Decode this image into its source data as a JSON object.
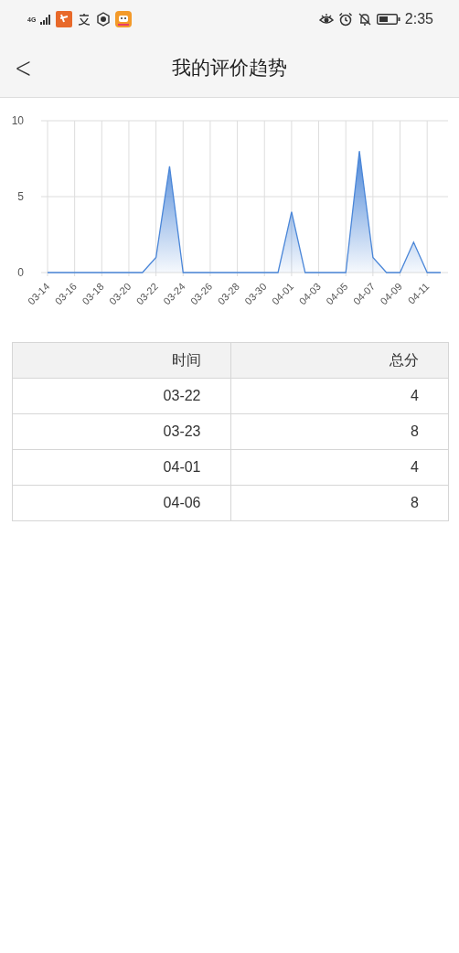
{
  "status_bar": {
    "network": "4G",
    "time": "2:35"
  },
  "header": {
    "back": "<",
    "title": "我的评价趋势"
  },
  "chart": {
    "chart_data": {
      "type": "area",
      "categories": [
        "03-14",
        null,
        "03-16",
        null,
        "03-18",
        null,
        "03-20",
        null,
        "03-22",
        null,
        "03-24",
        null,
        "03-26",
        null,
        "03-28",
        null,
        "03-30",
        null,
        "04-01",
        null,
        "04-03",
        null,
        "04-05",
        null,
        "04-07",
        null,
        "04-09",
        null,
        "04-11",
        null
      ],
      "series": [
        {
          "color": "#4a86d8",
          "values": [
            0,
            0,
            0,
            0,
            0,
            0,
            0,
            0,
            1,
            7,
            0,
            0,
            0,
            0,
            0,
            0,
            0,
            0,
            4,
            0,
            0,
            0,
            0,
            8,
            1,
            0,
            0,
            2,
            0,
            0
          ]
        }
      ],
      "ylim": [
        0,
        10
      ],
      "yticks": [
        0,
        5,
        10
      ],
      "grid": true
    }
  },
  "table": {
    "columns": [
      "时间",
      "总分"
    ],
    "rows": [
      [
        "03-22",
        "4"
      ],
      [
        "03-23",
        "8"
      ],
      [
        "04-01",
        "4"
      ],
      [
        "04-06",
        "8"
      ]
    ]
  }
}
